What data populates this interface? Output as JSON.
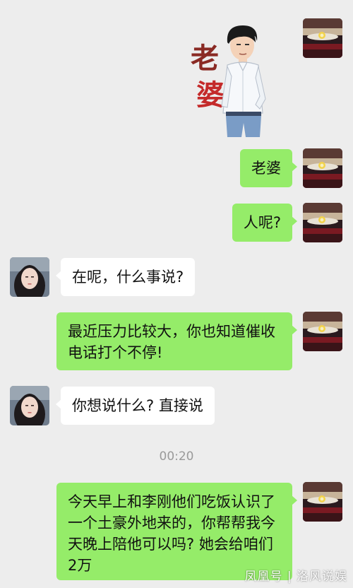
{
  "sticker": {
    "text": "老婆"
  },
  "messages": [
    {
      "side": "me",
      "text": "老婆"
    },
    {
      "side": "me",
      "text": "人呢?"
    },
    {
      "side": "her",
      "text": "在呢，什么事说?"
    },
    {
      "side": "me",
      "text": "最近压力比较大，你也知道催收电话打个不停!"
    },
    {
      "side": "her",
      "text": "你想说什么? 直接说"
    },
    {
      "side": "me",
      "text": "今天早上和李刚他们吃饭认识了一个土豪外地来的，你帮帮我今天晚上陪他可以吗? 她会给咱们2万"
    }
  ],
  "timestamp": "00:20",
  "watermark": "凤凰号 | 洛风说娱",
  "colors": {
    "background": "#ededed",
    "sent_bubble": "#95ec69",
    "received_bubble": "#ffffff"
  }
}
